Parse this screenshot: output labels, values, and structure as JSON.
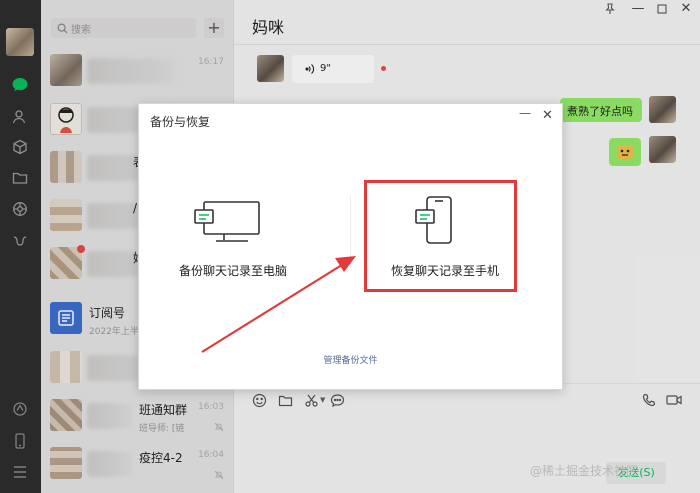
{
  "search": {
    "placeholder": "搜索"
  },
  "chat": {
    "title": "妈咪",
    "voice_duration": "9\"",
    "sticker_text": "煮熟了好点吗"
  },
  "list": {
    "items": [
      {
        "time": "16:17"
      },
      {
        "time": ""
      },
      {
        "name_frag": "表"
      },
      {
        "name_frag": "/"
      },
      {
        "name_frag": "妈"
      },
      {
        "name": "订阅号",
        "sub": "2022年上半"
      },
      {
        "name": ""
      },
      {
        "name": "班通知群",
        "sub": "班导师: [链",
        "time": "16:03"
      },
      {
        "name": "疫控4-2",
        "time": "16:04"
      }
    ]
  },
  "dialog": {
    "title": "备份与恢复",
    "backup_label": "备份聊天记录至电脑",
    "restore_label": "恢复聊天记录至手机",
    "manage_link": "管理备份文件"
  },
  "footer": {
    "send_label": "发送(S)",
    "watermark": "@稀土掘金技术社区"
  },
  "colors": {
    "accent": "#07c160",
    "highlight": "#e13a3a",
    "bubble": "#95ec69"
  }
}
